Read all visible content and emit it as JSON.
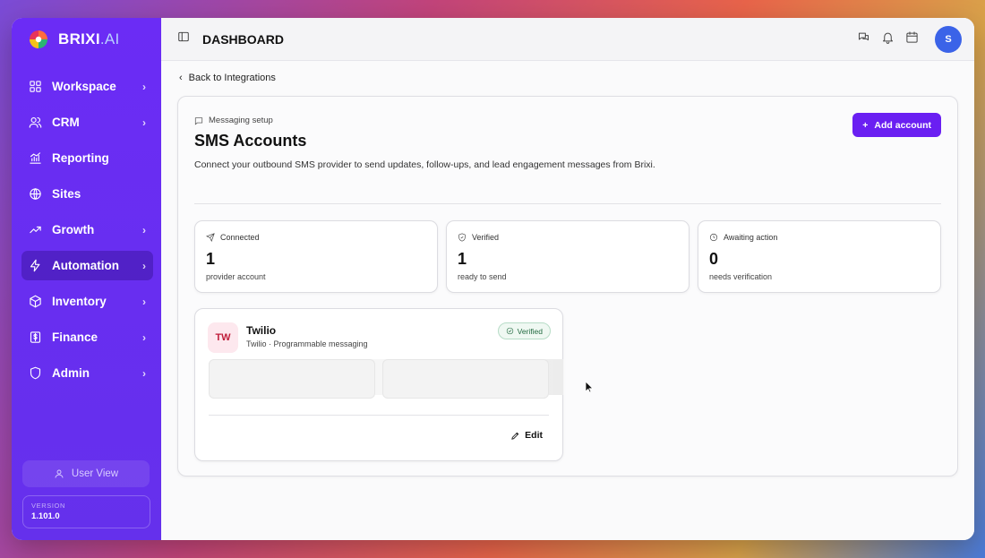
{
  "brand": {
    "name": "BRIXI",
    "suffix": ".AI"
  },
  "sidebar": {
    "items": [
      {
        "label": "Workspace",
        "icon": "grid-icon",
        "chevron": true
      },
      {
        "label": "CRM",
        "icon": "users-icon",
        "chevron": true
      },
      {
        "label": "Reporting",
        "icon": "chart-icon",
        "chevron": false
      },
      {
        "label": "Sites",
        "icon": "globe-icon",
        "chevron": false
      },
      {
        "label": "Growth",
        "icon": "trend-icon",
        "chevron": true
      },
      {
        "label": "Automation",
        "icon": "bolt-icon",
        "chevron": true,
        "active": true
      },
      {
        "label": "Inventory",
        "icon": "box-icon",
        "chevron": true
      },
      {
        "label": "Finance",
        "icon": "dollar-icon",
        "chevron": true
      },
      {
        "label": "Admin",
        "icon": "shield-icon",
        "chevron": true
      }
    ],
    "user_view": "User View",
    "version_label": "VERSION",
    "version_value": "1.101.0"
  },
  "header": {
    "title": "DASHBOARD",
    "avatar_initial": "S"
  },
  "back_link": "Back to Integrations",
  "page": {
    "kicker": "Messaging setup",
    "title": "SMS Accounts",
    "description": "Connect your outbound SMS provider to send updates, follow-ups, and lead engagement messages from Brixi.",
    "add_button": "Add account"
  },
  "stats": [
    {
      "label": "Connected",
      "value": "1",
      "sub": "provider account",
      "icon": "send-icon"
    },
    {
      "label": "Verified",
      "value": "1",
      "sub": "ready to send",
      "icon": "shield-check-icon"
    },
    {
      "label": "Awaiting action",
      "value": "0",
      "sub": "needs verification",
      "icon": "clock-icon"
    }
  ],
  "provider": {
    "initials": "TW",
    "name": "Twilio",
    "subtitle": "Twilio · Programmable messaging",
    "badge": "Verified",
    "edit": "Edit"
  },
  "colors": {
    "sidebar": "#6a2df0",
    "accent": "#6a1ff2",
    "avatar": "#3b63e8"
  }
}
